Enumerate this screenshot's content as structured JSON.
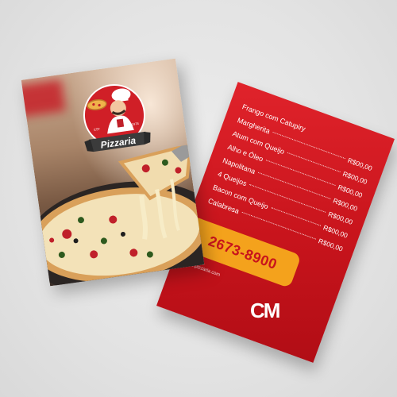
{
  "logo": {
    "brand": "Pizzaria",
    "est_left": "EST",
    "est_right": "1978"
  },
  "menu": {
    "items": [
      {
        "name": "Frango com Catupiry",
        "price": ""
      },
      {
        "name": "Margherita",
        "price": "R$00,00"
      },
      {
        "name": "Atum com Queijo",
        "price": "R$00,00"
      },
      {
        "name": "Alho e Óleo",
        "price": "R$00,00"
      },
      {
        "name": "Napolitana",
        "price": "R$00,00"
      },
      {
        "name": "4 Queijos",
        "price": "R$00,00"
      },
      {
        "name": "Bacon com Queijo",
        "price": "R$00,00"
      },
      {
        "name": "Calabresa",
        "price": "R$00,00"
      }
    ],
    "phone": "2673-8900",
    "website": "www.pizzaria.com",
    "brand_mark": "CM"
  },
  "colors": {
    "menu_red": "#d11a22",
    "phone_box": "#f4a21c",
    "background": "#e5e5e5"
  }
}
